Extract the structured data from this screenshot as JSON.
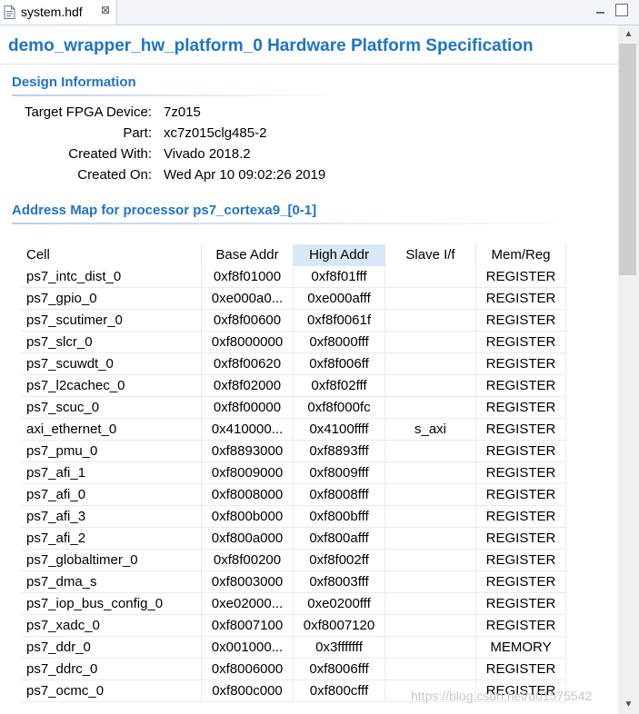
{
  "tab": {
    "label": "system.hdf",
    "close": "⊠"
  },
  "page": {
    "title": "demo_wrapper_hw_platform_0 Hardware Platform Specification"
  },
  "design": {
    "heading": "Design Information",
    "fields": [
      {
        "label": "Target FPGA Device:",
        "value": "7z015"
      },
      {
        "label": "Part:",
        "value": "xc7z015clg485-2"
      },
      {
        "label": "Created With:",
        "value": "Vivado 2018.2"
      },
      {
        "label": "Created On:",
        "value": "Wed Apr 10 09:02:26 2019"
      }
    ]
  },
  "address_map": {
    "heading": "Address Map for processor ps7_cortexa9_[0-1]",
    "columns": [
      "Cell",
      "Base Addr",
      "High Addr",
      "Slave I/f",
      "Mem/Reg"
    ],
    "rows": [
      [
        "ps7_intc_dist_0",
        "0xf8f01000",
        "0xf8f01fff",
        "",
        "REGISTER"
      ],
      [
        "ps7_gpio_0",
        "0xe000a0...",
        "0xe000afff",
        "",
        "REGISTER"
      ],
      [
        "ps7_scutimer_0",
        "0xf8f00600",
        "0xf8f0061f",
        "",
        "REGISTER"
      ],
      [
        "ps7_slcr_0",
        "0xf8000000",
        "0xf8000fff",
        "",
        "REGISTER"
      ],
      [
        "ps7_scuwdt_0",
        "0xf8f00620",
        "0xf8f006ff",
        "",
        "REGISTER"
      ],
      [
        "ps7_l2cachec_0",
        "0xf8f02000",
        "0xf8f02fff",
        "",
        "REGISTER"
      ],
      [
        "ps7_scuc_0",
        "0xf8f00000",
        "0xf8f000fc",
        "",
        "REGISTER"
      ],
      [
        "axi_ethernet_0",
        "0x410000...",
        "0x4100ffff",
        "s_axi",
        "REGISTER"
      ],
      [
        "ps7_pmu_0",
        "0xf8893000",
        "0xf8893fff",
        "",
        "REGISTER"
      ],
      [
        "ps7_afi_1",
        "0xf8009000",
        "0xf8009fff",
        "",
        "REGISTER"
      ],
      [
        "ps7_afi_0",
        "0xf8008000",
        "0xf8008fff",
        "",
        "REGISTER"
      ],
      [
        "ps7_afi_3",
        "0xf800b000",
        "0xf800bfff",
        "",
        "REGISTER"
      ],
      [
        "ps7_afi_2",
        "0xf800a000",
        "0xf800afff",
        "",
        "REGISTER"
      ],
      [
        "ps7_globaltimer_0",
        "0xf8f00200",
        "0xf8f002ff",
        "",
        "REGISTER"
      ],
      [
        "ps7_dma_s",
        "0xf8003000",
        "0xf8003fff",
        "",
        "REGISTER"
      ],
      [
        "ps7_iop_bus_config_0",
        "0xe02000...",
        "0xe0200fff",
        "",
        "REGISTER"
      ],
      [
        "ps7_xadc_0",
        "0xf8007100",
        "0xf8007120",
        "",
        "REGISTER"
      ],
      [
        "ps7_ddr_0",
        "0x001000...",
        "0x3fffffff",
        "",
        "MEMORY"
      ],
      [
        "ps7_ddrc_0",
        "0xf8006000",
        "0xf8006fff",
        "",
        "REGISTER"
      ],
      [
        "ps7_ocmc_0",
        "0xf800c000",
        "0xf800cfff",
        "",
        "REGISTER"
      ]
    ]
  },
  "watermark": "https://blog.csdn.net/u01575542"
}
